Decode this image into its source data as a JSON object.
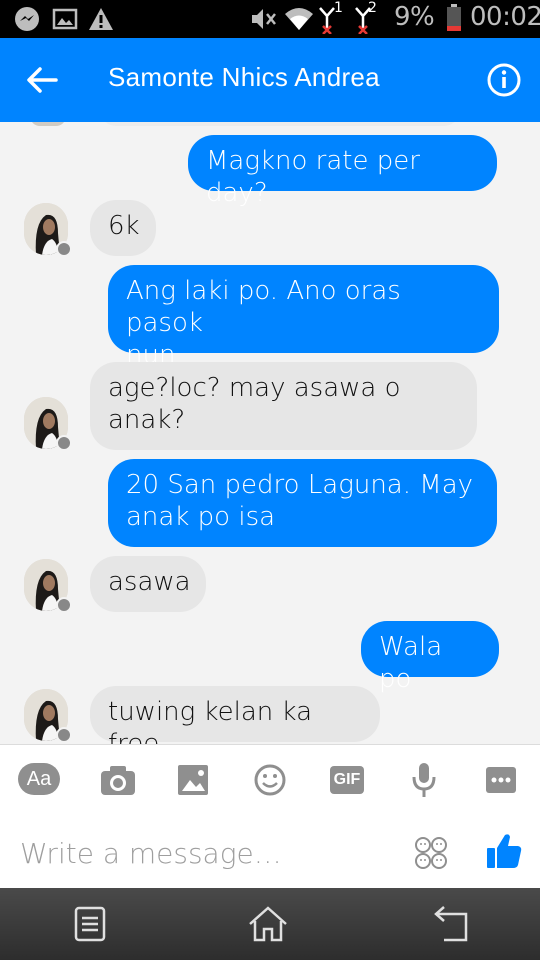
{
  "status_bar": {
    "battery_percent": "9%",
    "time": "00:02",
    "sim1_label": "1",
    "sim2_label": "2"
  },
  "header": {
    "contact_name": "Samonte Nhics Andrea"
  },
  "messages": [
    {
      "direction": "out",
      "text": "Magkno rate per day?"
    },
    {
      "direction": "in",
      "text": "6k"
    },
    {
      "direction": "out",
      "text": "Ang laki po. Ano oras pasok\nnun"
    },
    {
      "direction": "in",
      "text": "age?loc? may asawa o\nanak?"
    },
    {
      "direction": "out",
      "text": "20 San pedro Laguna. May\nanak po isa"
    },
    {
      "direction": "in",
      "text": "asawa"
    },
    {
      "direction": "out",
      "text": "Wala po"
    },
    {
      "direction": "in",
      "text": "tuwing kelan ka free"
    }
  ],
  "composer": {
    "text_format_label": "Aa",
    "gif_label": "GIF",
    "placeholder": "Write a message…",
    "icons": [
      "text-format-icon",
      "camera-icon",
      "gallery-icon",
      "emoji-icon",
      "gif-icon",
      "microphone-icon",
      "more-icon",
      "sticker-faces-icon",
      "thumbs-up-icon"
    ]
  },
  "colors": {
    "accent": "#0084ff",
    "incoming_bubble": "#e6e6e6",
    "background": "#f3f3f3"
  }
}
